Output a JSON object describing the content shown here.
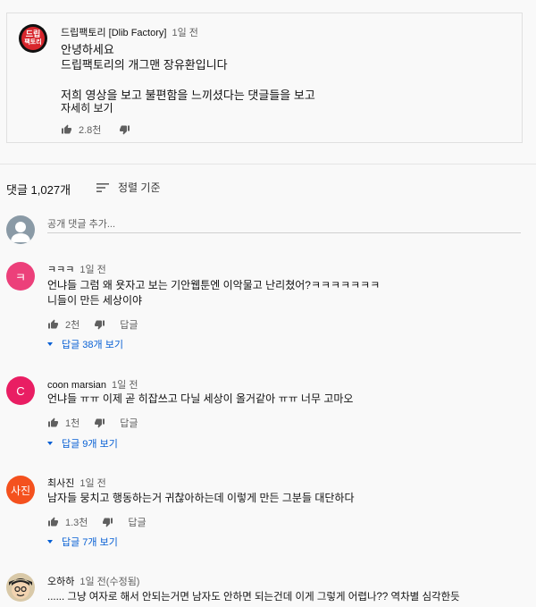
{
  "pinned": {
    "author": "드립팩토리 [Dlib Factory]",
    "time": "1일 전",
    "lines": [
      "안녕하세요",
      "드립팩토리의 개그맨 장유환입니다",
      "",
      "저희 영상을 보고 불편함을 느끼셨다는 댓글들을 보고"
    ],
    "read_more": "자세히 보기",
    "likes": "2.8천",
    "avatar_text": [
      "드립",
      "팩토리"
    ]
  },
  "comments_header": {
    "count": "댓글 1,027개",
    "sort": "정렬 기준"
  },
  "add_comment": {
    "placeholder": "공개 댓글 추가..."
  },
  "comments": [
    {
      "avatar_letter": "ㅋ",
      "avatar_color": "#ec407a",
      "author": "ㅋㅋㅋ",
      "time": "1일 전",
      "lines": [
        "언냐들 그럼 왜 욧자고 보는 기안웹툰엔 이악물고 난리쳤어?ㅋㅋㅋㅋㅋㅋㅋ",
        "니들이 만든 세상이야"
      ],
      "likes": "2천",
      "reply": "답글",
      "replies": "답글 38개 보기"
    },
    {
      "avatar_letter": "C",
      "avatar_color": "#e91e63",
      "author": "coon marsian",
      "time": "1일 전",
      "lines": [
        "언냐들 ㅠㅠ 이제 곧 히잡쓰고 다닐 세상이 올거같아 ㅠㅠ 너무 고마오"
      ],
      "likes": "1천",
      "reply": "답글",
      "replies": "답글 9개 보기"
    },
    {
      "avatar_letter": "사진",
      "avatar_color": "#f4511e",
      "author": "최사진",
      "time": "1일 전",
      "lines": [
        "남자들 뭉치고 행동하는거 귀찮아하는데 이렇게 만든 그분들 대단하다"
      ],
      "likes": "1.3천",
      "reply": "답글",
      "replies": "답글 7개 보기"
    },
    {
      "avatar_letter": "",
      "avatar_color": "#d9c9a8",
      "author": "오하하",
      "time": "1일 전(수정됨)",
      "lines": [
        "...... 그냥 여자로 해서 안되는거면 남자도  안하면 되는건데  이게 그렇게 어렵나??  역차별 심각한듯"
      ],
      "likes": "",
      "reply": "",
      "replies": ""
    }
  ],
  "colors": {
    "link": "#065fd4",
    "meta": "#606060",
    "brand": "#d8262d"
  }
}
